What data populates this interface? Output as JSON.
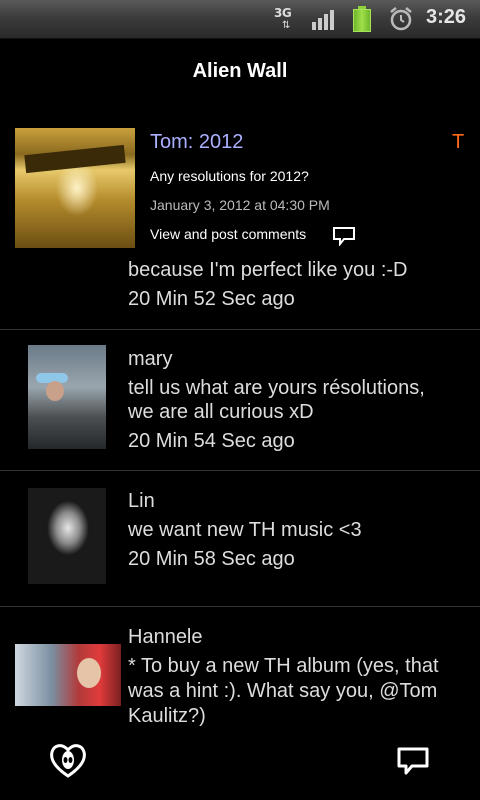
{
  "status_bar": {
    "network": "3G",
    "time": "3:26"
  },
  "header": {
    "title": "Alien Wall"
  },
  "post": {
    "title": "Tom: 2012",
    "tag": "T",
    "question": "Any resolutions for 2012?",
    "date": "January 3, 2012 at 04:30 PM",
    "link": "View and post comments",
    "title_color": "#aab0ff",
    "tag_color": "#ff6a1a"
  },
  "comments": [
    {
      "user": "",
      "text": "because I'm perfect like you :-D",
      "time": "20 Min 52 Sec ago"
    },
    {
      "user": "mary",
      "text_lines": [
        "tell us what are yours résolutions,",
        "we are all curious xD"
      ],
      "time": "20 Min 54 Sec ago"
    },
    {
      "user": "Lin",
      "text": "we want new TH music <3",
      "time": "20 Min 58 Sec ago"
    },
    {
      "user": "Hannele",
      "text_lines": [
        "* To buy a new TH album (yes, that",
        "was a hint :). What say you, @Tom",
        "Kaulitz?)"
      ]
    }
  ],
  "icons": {
    "logo": "alien-heart-logo-icon",
    "chat": "speech-bubble-icon"
  }
}
